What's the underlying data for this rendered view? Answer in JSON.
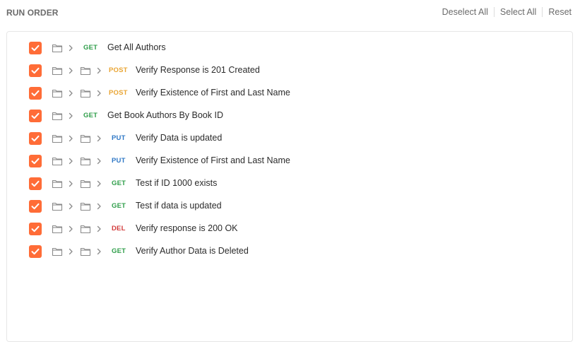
{
  "header": {
    "title": "RUN ORDER",
    "deselect_all": "Deselect All",
    "select_all": "Select All",
    "reset": "Reset"
  },
  "colors": {
    "checkbox": "#ff6c37",
    "GET": "#2f9e4a",
    "POST": "#e9a534",
    "PUT": "#2f78c6",
    "DEL": "#d33c3c"
  },
  "items": [
    {
      "checked": true,
      "depth": 1,
      "method": "GET",
      "name": "Get All Authors"
    },
    {
      "checked": true,
      "depth": 2,
      "method": "POST",
      "name": "Verify Response is 201 Created"
    },
    {
      "checked": true,
      "depth": 2,
      "method": "POST",
      "name": "Verify Existence of First and Last Name"
    },
    {
      "checked": true,
      "depth": 1,
      "method": "GET",
      "name": "Get Book Authors By Book ID"
    },
    {
      "checked": true,
      "depth": 2,
      "method": "PUT",
      "name": "Verify Data is updated"
    },
    {
      "checked": true,
      "depth": 2,
      "method": "PUT",
      "name": "Verify Existence of First and Last Name"
    },
    {
      "checked": true,
      "depth": 2,
      "method": "GET",
      "name": "Test if ID 1000 exists"
    },
    {
      "checked": true,
      "depth": 2,
      "method": "GET",
      "name": "Test if data is updated"
    },
    {
      "checked": true,
      "depth": 2,
      "method": "DEL",
      "name": "Verify response is 200 OK"
    },
    {
      "checked": true,
      "depth": 2,
      "method": "GET",
      "name": "Verify Author Data is Deleted"
    }
  ]
}
